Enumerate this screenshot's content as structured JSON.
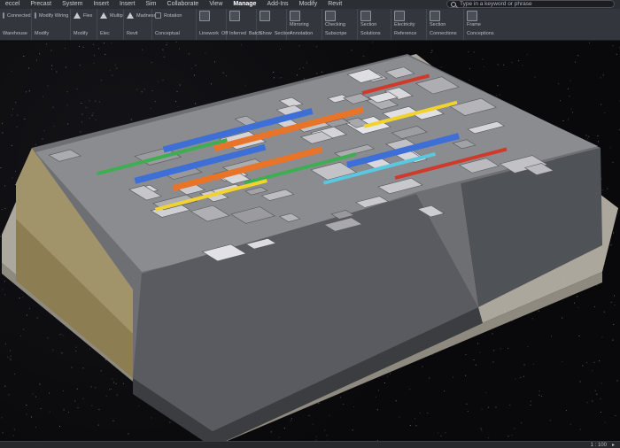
{
  "ribbon": {
    "tabs": [
      {
        "label": "Precast"
      },
      {
        "label": "System"
      },
      {
        "label": "Insert"
      },
      {
        "label": "Insert"
      },
      {
        "label": "Sim"
      },
      {
        "label": "Collaborate"
      },
      {
        "label": "View"
      },
      {
        "label": "Manage"
      },
      {
        "label": "Add-Ins"
      },
      {
        "label": "Modify"
      },
      {
        "label": "Revit"
      }
    ],
    "left_stub": "eccel",
    "search_placeholder": "Type in a keyword or phrase",
    "groups": [
      {
        "top": "Connected",
        "bottom": "Warehouse"
      },
      {
        "top": "Modify Wiring",
        "bottom": "Modify"
      },
      {
        "top": "Flex",
        "bottom": "Modify"
      },
      {
        "top": "Multip",
        "bottom": "Elec"
      },
      {
        "top": "Madness",
        "bottom": "Revit"
      },
      {
        "top": "Rotation",
        "bottom": "Conceptual"
      },
      {
        "top": "Linework",
        "bottom": "Off"
      },
      {
        "top": "Inferred",
        "bottom": "Batch"
      },
      {
        "top": "Show",
        "bottom": "Section"
      },
      {
        "top": "Mirroring",
        "bottom": "Annotation"
      },
      {
        "top": "Checking",
        "bottom": "Subscripe"
      },
      {
        "top": "Section",
        "bottom": "Solutions"
      },
      {
        "top": "Electricity",
        "bottom": "Reference"
      },
      {
        "top": "Section",
        "bottom": "Connections"
      },
      {
        "top": "Frame",
        "bottom": "Conceptions"
      }
    ]
  },
  "status": {
    "scale": "1 : 100"
  },
  "icons": {
    "search": "search-icon",
    "ribbon_tool": "tool-icon"
  },
  "colors": {
    "ribbon_bg": "#33363c",
    "tab_bar_bg": "#2b2e33",
    "viewport_bg": "#0a0a0c",
    "duct_orange": "#e8742a",
    "duct_blue": "#3e6fd6",
    "pipe_green": "#3fae52",
    "wall_grey": "#8d8f93"
  }
}
